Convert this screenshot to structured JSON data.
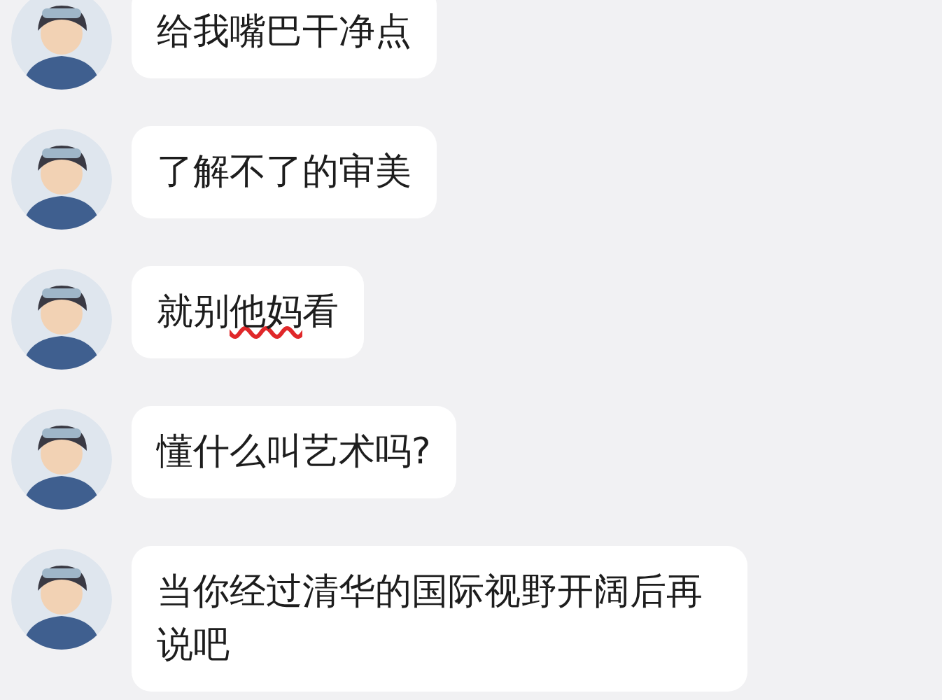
{
  "messages": [
    {
      "segments": [
        {
          "text": "给我嘴巴干净点",
          "scribbled": false
        }
      ]
    },
    {
      "segments": [
        {
          "text": "了解不了的审美",
          "scribbled": false
        }
      ]
    },
    {
      "segments": [
        {
          "text": "就别",
          "scribbled": false
        },
        {
          "text": "他妈",
          "scribbled": true
        },
        {
          "text": "看",
          "scribbled": false
        }
      ]
    },
    {
      "segments": [
        {
          "text": "懂什么叫艺术吗?",
          "scribbled": false
        }
      ]
    },
    {
      "segments": [
        {
          "text": "当你经过清华的国际视野开阔后再说吧",
          "scribbled": false
        }
      ]
    }
  ]
}
